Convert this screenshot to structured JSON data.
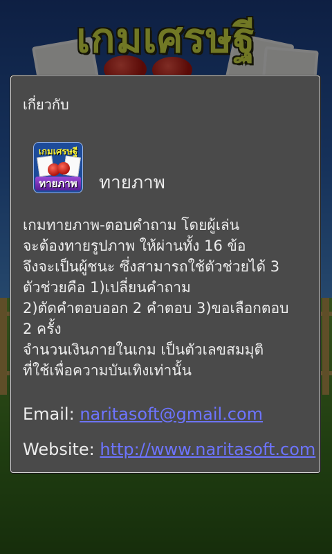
{
  "background": {
    "game_title": "เกมเศรษฐี"
  },
  "dialog": {
    "title": "เกี่ยวกับ",
    "app": {
      "icon_top_text": "เกมเศรษฐี",
      "icon_bottom_text": "ทายภาพ",
      "name": "ทายภาพ"
    },
    "description_lines": [
      "เกมทายภาพ-ตอบคำถาม โดยผู้เล่น",
      "จะต้องทายรูปภาพ ให้ผ่านทั้ง 16 ข้อ",
      "จึงจะเป็นผู้ชนะ ซึ่งสามารถใช้ตัวช่วยได้ 3",
      "ตัวช่วยคือ 1)เปลี่ยนคำถาม",
      "2)ตัดคำตอบออก 2 คำตอบ 3)ขอเลือกตอบ",
      "2 ครั้ง",
      "จำนวนเงินภายในเกม เป็นตัวเลขสมมุติ",
      "ที่ใช้เพื่อความบันเทิงเท่านั้น"
    ],
    "email_label": "Email: ",
    "email": "naritasoft@gmail.com",
    "website_label": "Website: ",
    "website": "http://www.naritasoft.com"
  },
  "colors": {
    "dialog_bg": "#4a4a4a",
    "link": "#6d74ff",
    "title_yellow": "#e3f04a"
  }
}
